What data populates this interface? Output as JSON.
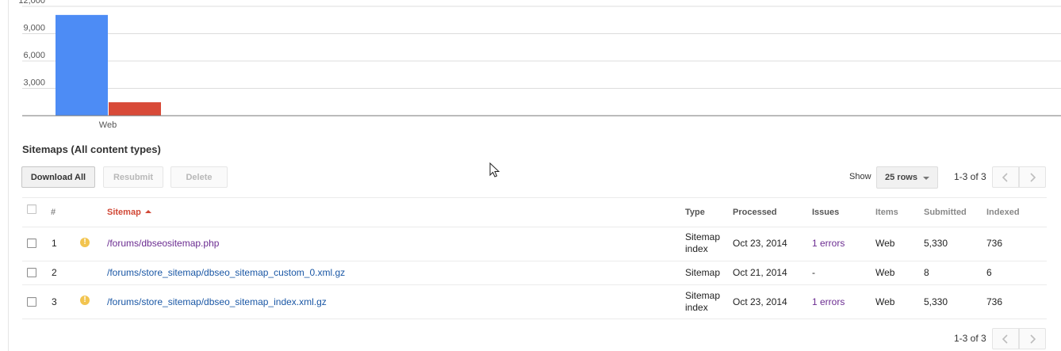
{
  "chart_data": {
    "type": "bar",
    "categories": [
      "Web"
    ],
    "series": [
      {
        "color": "#4d8cf5",
        "values": [
          11056
        ]
      },
      {
        "color": "#d84a38",
        "values": [
          1472
        ]
      }
    ],
    "ylim": [
      0,
      12000
    ],
    "yticks": [
      3000,
      6000,
      9000,
      12000
    ],
    "ytick_labels": [
      "3,000",
      "6,000",
      "9,000",
      "12,000"
    ],
    "grid": true
  },
  "section": {
    "title": "Sitemaps (All content types)"
  },
  "toolbar": {
    "download_all": "Download All",
    "resubmit": "Resubmit",
    "delete": "Delete",
    "show_label": "Show",
    "rows_value": "25 rows",
    "page_info": "1-3 of 3",
    "prev_icon": "chevron-left-icon",
    "next_icon": "chevron-right-icon"
  },
  "table": {
    "headers": {
      "num": "#",
      "sitemap": "Sitemap",
      "type": "Type",
      "processed": "Processed",
      "issues": "Issues",
      "items": "Items",
      "submitted": "Submitted",
      "indexed": "Indexed"
    },
    "rows": [
      {
        "num": "1",
        "warning": "!",
        "sitemap": "/forums/dbseositemap.php",
        "type_line1": "Sitemap",
        "type_line2": "index",
        "processed": "Oct 23, 2014",
        "issues": "1 errors",
        "items": "Web",
        "submitted": "5,330",
        "indexed": "736"
      },
      {
        "num": "2",
        "warning": "",
        "sitemap": "/forums/store_sitemap/dbseo_sitemap_custom_0.xml.gz",
        "type_line1": "Sitemap",
        "type_line2": "",
        "processed": "Oct 21, 2014",
        "issues": "-",
        "items": "Web",
        "submitted": "8",
        "indexed": "6"
      },
      {
        "num": "3",
        "warning": "!",
        "sitemap": "/forums/store_sitemap/dbseo_sitemap_index.xml.gz",
        "type_line1": "Sitemap",
        "type_line2": "index",
        "processed": "Oct 23, 2014",
        "issues": "1 errors",
        "items": "Web",
        "submitted": "5,330",
        "indexed": "736"
      }
    ]
  },
  "footer": {
    "page_info": "1-3 of 3"
  }
}
